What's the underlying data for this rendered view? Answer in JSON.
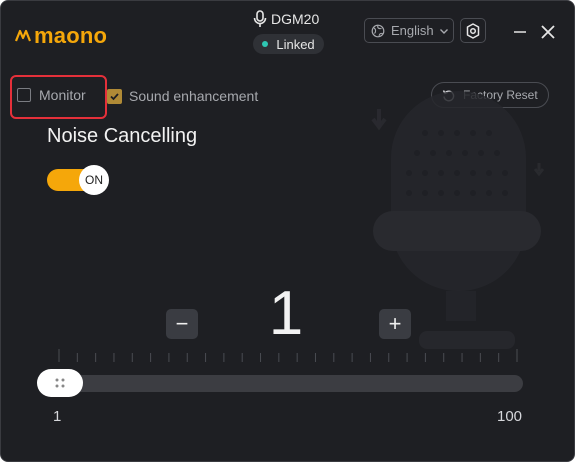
{
  "app": {
    "brand": "maono",
    "accent": "#f5a70a"
  },
  "device": {
    "name": "DGM20",
    "status": "Linked",
    "status_color": "#2ec7b3",
    "icon": "microphone-icon"
  },
  "header": {
    "language": "English",
    "settings_icon": "settings-icon"
  },
  "controls": {
    "monitor_label": "Monitor",
    "monitor_checked": false,
    "enhancement_label": "Sound enhancement",
    "enhancement_checked": true,
    "factory_reset_label": "Factory Reset"
  },
  "noise_cancelling": {
    "title": "Noise Cancelling",
    "toggle_label": "ON",
    "enabled": true,
    "value": "1",
    "minus_label": "−",
    "plus_label": "+",
    "min_label": "1",
    "max_label": "100",
    "min": 1,
    "max": 100,
    "current": 1
  }
}
